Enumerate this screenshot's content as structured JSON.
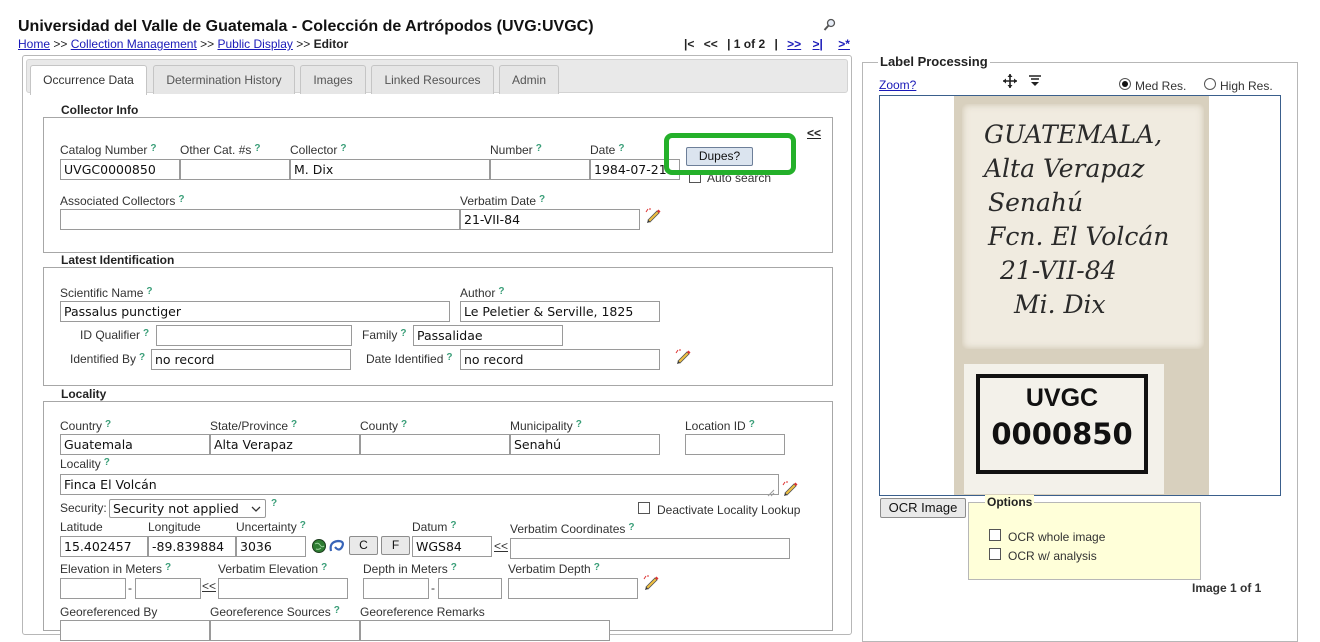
{
  "header": {
    "title": "Universidad del Valle de Guatemala - Colección de Artrópodos (UVG:UVGC)",
    "breadcrumb": {
      "home": "Home",
      "sep": ">>",
      "collection_management": "Collection Management",
      "public_display": "Public Display",
      "current": "Editor"
    },
    "pager": {
      "first": "|<",
      "prev": "<<",
      "bar": "|",
      "current": "1 of 2",
      "bar2": "|",
      "next": ">>",
      "last": ">|",
      "new": ">*"
    }
  },
  "tabs": [
    "Occurrence Data",
    "Determination History",
    "Images",
    "Linked Resources",
    "Admin"
  ],
  "collector_info": {
    "legend": "Collector Info",
    "catalog_number_label": "Catalog Number",
    "catalog_number": "UVGC0000850",
    "other_cat_label": "Other Cat. #s",
    "other_cat": "",
    "collector_label": "Collector",
    "collector": "M. Dix",
    "number_label": "Number",
    "number": "",
    "date_label": "Date",
    "date": "1984-07-21",
    "dupes_button": "Dupes?",
    "auto_search": "Auto search",
    "collapse": "<<",
    "associated_collectors_label": "Associated Collectors",
    "associated_collectors": "",
    "verbatim_date_label": "Verbatim Date",
    "verbatim_date": "21-VII-84"
  },
  "latest_identification": {
    "legend": "Latest Identification",
    "scientific_name_label": "Scientific Name",
    "scientific_name": "Passalus punctiger",
    "author_label": "Author",
    "author": "Le Peletier & Serville, 1825",
    "id_qualifier_label": "ID Qualifier",
    "id_qualifier": "",
    "family_label": "Family",
    "family": "Passalidae",
    "identified_by_label": "Identified By",
    "identified_by": "no record",
    "date_identified_label": "Date Identified",
    "date_identified": "no record"
  },
  "locality": {
    "legend": "Locality",
    "country_label": "Country",
    "country": "Guatemala",
    "state_label": "State/Province",
    "state": "Alta Verapaz",
    "county_label": "County",
    "county": "",
    "municipality_label": "Municipality",
    "municipality": "Senahú",
    "location_id_label": "Location ID",
    "location_id": "",
    "locality_label": "Locality",
    "locality": "Finca El Volcán",
    "security_label": "Security:",
    "security": "Security not applied",
    "deactivate_lookup": "Deactivate Locality Lookup",
    "latitude_label": "Latitude",
    "latitude": "15.402457",
    "longitude_label": "Longitude",
    "longitude": "-89.839884",
    "uncertainty_label": "Uncertainty",
    "uncertainty": "3036",
    "c_button": "C",
    "f_button": "F",
    "datum_label": "Datum",
    "datum": "WGS84",
    "arrow": "<<",
    "verbatim_coords_label": "Verbatim Coordinates",
    "verbatim_coords": "",
    "elevation_label": "Elevation in Meters",
    "elev_min": "",
    "dash": "-",
    "elev_max": "",
    "verbatim_elevation_label": "Verbatim Elevation",
    "verbatim_elevation": "",
    "depth_label": "Depth in Meters",
    "depth_min": "",
    "depth_max": "",
    "verbatim_depth_label": "Verbatim Depth",
    "verbatim_depth": "",
    "georef_by_label": "Georeferenced By",
    "georef_sources_label": "Georeference Sources",
    "georef_remarks_label": "Georeference Remarks"
  },
  "label_processing": {
    "title": "Label Processing",
    "zoom": "Zoom?",
    "med_res": "Med Res.",
    "high_res": "High Res.",
    "label_text": [
      "GUATEMALA,",
      "Alta Verapaz",
      "Senahú",
      "Fcn. El Volcán",
      "21-VII-84",
      "Mi. Dix"
    ],
    "code_label": [
      "UVGC",
      "0000850"
    ],
    "ocr_button": "OCR Image",
    "options_legend": "Options",
    "ocr_whole": "OCR whole image",
    "ocr_analysis": "OCR w/ analysis",
    "image_count": "Image 1 of 1"
  },
  "colors": {
    "highlight": "#24b02a",
    "link": "#1a1ab8",
    "help": "#3a9e78"
  }
}
